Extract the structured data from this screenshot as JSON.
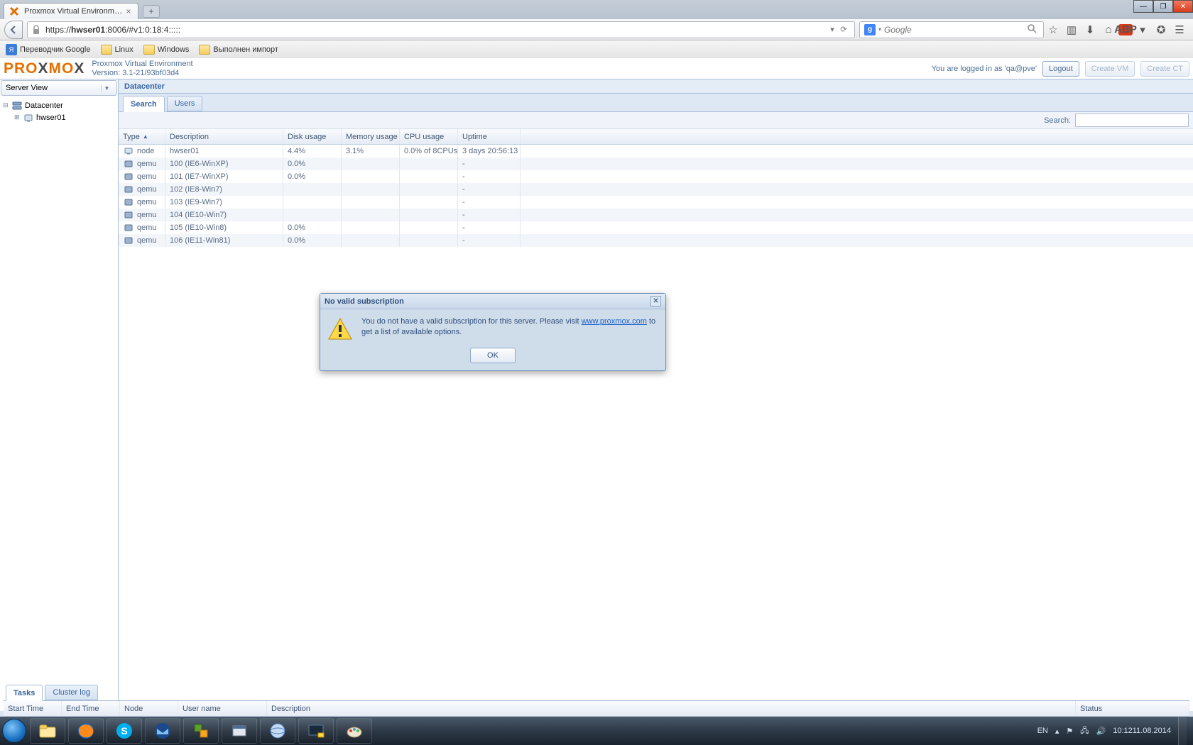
{
  "browser": {
    "tab_title": "Proxmox Virtual Environme...",
    "url_host": "hwser01",
    "url_rest": ":8006/#v1:0:18:4:::::",
    "url_prefix": "https://",
    "search_placeholder": "Google"
  },
  "bookmarks": [
    {
      "label": "Переводчик Google",
      "type": "trans"
    },
    {
      "label": "Linux",
      "type": "folder"
    },
    {
      "label": "Windows",
      "type": "folder"
    },
    {
      "label": "Выполнен импорт",
      "type": "folder"
    }
  ],
  "header": {
    "product": "Proxmox Virtual Environment",
    "version": "Version: 3.1-21/93bf03d4",
    "logged_in": "You are logged in as 'qa@pve'",
    "logout": "Logout",
    "create_vm": "Create VM",
    "create_ct": "Create CT"
  },
  "sidebar": {
    "view_label": "Server View",
    "root": "Datacenter",
    "node": "hwser01"
  },
  "breadcrumb": "Datacenter",
  "tabs": {
    "search": "Search",
    "users": "Users"
  },
  "search_label": "Search:",
  "columns": {
    "type": "Type",
    "desc": "Description",
    "disk": "Disk usage",
    "mem": "Memory usage",
    "cpu": "CPU usage",
    "uptime": "Uptime"
  },
  "rows": [
    {
      "type": "node",
      "desc": "hwser01",
      "disk": "4.4%",
      "mem": "3.1%",
      "cpu": "0.0% of 8CPUs",
      "uptime": "3 days 20:56:13",
      "icon": "node"
    },
    {
      "type": "qemu",
      "desc": "100 (IE6-WinXP)",
      "disk": "0.0%",
      "mem": "",
      "cpu": "",
      "uptime": "-",
      "icon": "vm"
    },
    {
      "type": "qemu",
      "desc": "101 (IE7-WinXP)",
      "disk": "0.0%",
      "mem": "",
      "cpu": "",
      "uptime": "-",
      "icon": "vm"
    },
    {
      "type": "qemu",
      "desc": "102 (IE8-Win7)",
      "disk": "",
      "mem": "",
      "cpu": "",
      "uptime": "-",
      "icon": "vm"
    },
    {
      "type": "qemu",
      "desc": "103 (IE9-Win7)",
      "disk": "",
      "mem": "",
      "cpu": "",
      "uptime": "-",
      "icon": "vm"
    },
    {
      "type": "qemu",
      "desc": "104 (IE10-Win7)",
      "disk": "",
      "mem": "",
      "cpu": "",
      "uptime": "-",
      "icon": "vm"
    },
    {
      "type": "qemu",
      "desc": "105 (IE10-Win8)",
      "disk": "0.0%",
      "mem": "",
      "cpu": "",
      "uptime": "-",
      "icon": "vm"
    },
    {
      "type": "qemu",
      "desc": "106 (IE11-Win81)",
      "disk": "0.0%",
      "mem": "",
      "cpu": "",
      "uptime": "-",
      "icon": "vm"
    }
  ],
  "bottom_tabs": {
    "tasks": "Tasks",
    "cluster": "Cluster log"
  },
  "bottom_cols": {
    "start": "Start Time",
    "end": "End Time",
    "node": "Node",
    "user": "User name",
    "desc": "Description",
    "status": "Status"
  },
  "modal": {
    "title": "No valid subscription",
    "text_before": "You do not have a valid subscription for this server. Please visit ",
    "link": "www.proxmox.com",
    "text_after": " to get a list of available options.",
    "ok": "OK"
  },
  "tray": {
    "lang": "EN",
    "time": "10:12",
    "date": "11.08.2014"
  }
}
